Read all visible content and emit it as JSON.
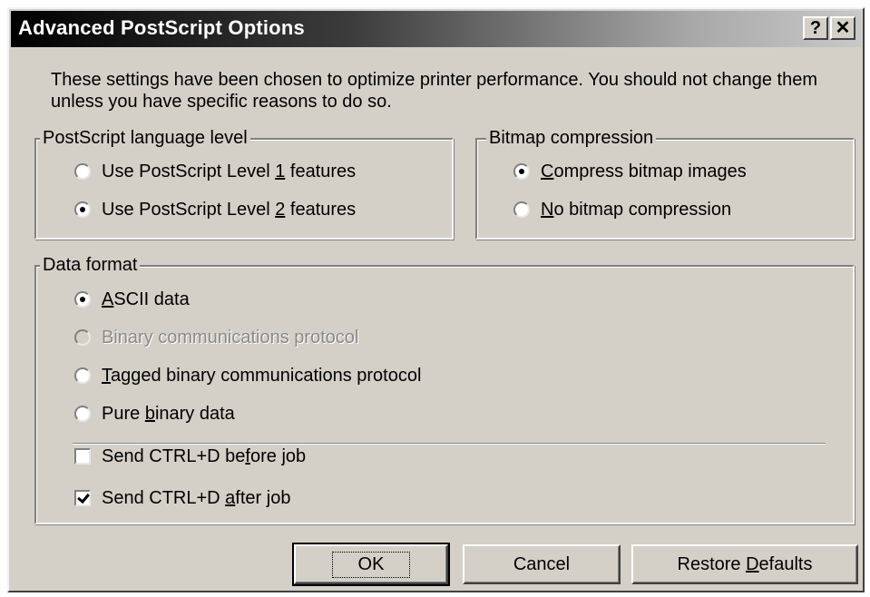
{
  "window": {
    "title": "Advanced PostScript Options",
    "help_glyph": "?",
    "close_glyph": "✕"
  },
  "intro": "These settings have been chosen to optimize printer performance. You should not change them unless you have specific reasons to do so.",
  "language_level": {
    "legend": "PostScript language level",
    "options": [
      {
        "pre": "Use PostScript Level ",
        "key": "1",
        "post": " features",
        "selected": false
      },
      {
        "pre": "Use PostScript Level ",
        "key": "2",
        "post": " features",
        "selected": true
      }
    ]
  },
  "bitmap": {
    "legend": "Bitmap compression",
    "options": [
      {
        "pre": "",
        "key": "C",
        "post": "ompress bitmap images",
        "selected": true
      },
      {
        "pre": "",
        "key": "N",
        "post": "o bitmap compression",
        "selected": false
      }
    ]
  },
  "data_format": {
    "legend": "Data format",
    "options": [
      {
        "pre": "",
        "key": "A",
        "post": "SCII data",
        "selected": true,
        "enabled": true
      },
      {
        "pre": "Binary communications protocol",
        "key": "",
        "post": "",
        "selected": false,
        "enabled": false
      },
      {
        "pre": "",
        "key": "T",
        "post": "agged binary communications protocol",
        "selected": false,
        "enabled": true
      },
      {
        "pre": "Pure ",
        "key": "b",
        "post": "inary data",
        "selected": false,
        "enabled": true
      }
    ],
    "checks": [
      {
        "pre": "Send CTRL+D be",
        "key": "f",
        "post": "ore job",
        "checked": false
      },
      {
        "pre": "Send CTRL+D ",
        "key": "a",
        "post": "fter job",
        "checked": true
      }
    ]
  },
  "buttons": {
    "ok": "OK",
    "cancel": "Cancel",
    "restore_pre": "Restore ",
    "restore_key": "D",
    "restore_post": "efaults"
  }
}
